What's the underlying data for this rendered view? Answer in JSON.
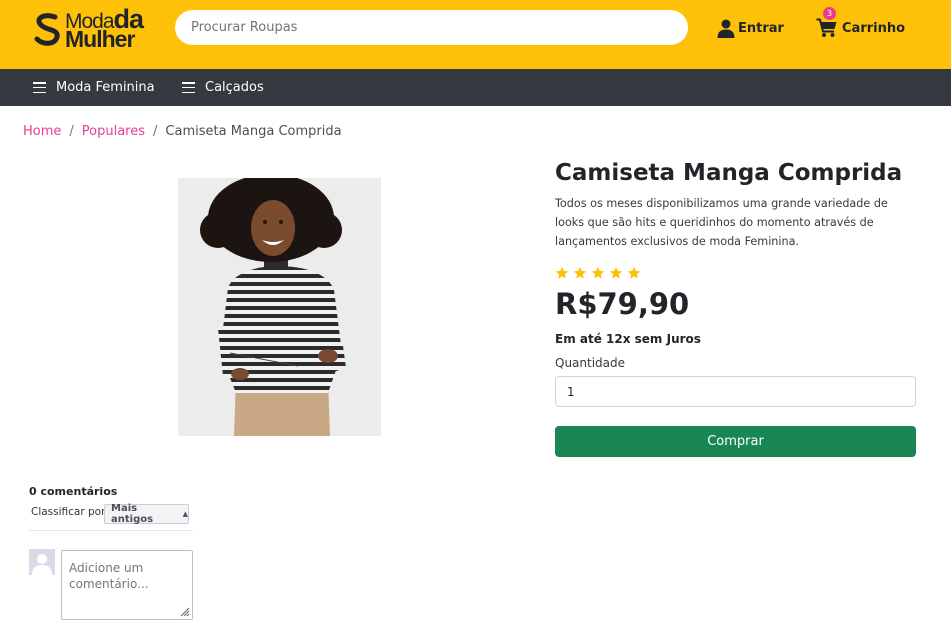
{
  "header": {
    "logo": {
      "line1_part1": "Moda",
      "line1_part2": "da",
      "line2": "Mulher"
    },
    "search": {
      "placeholder": "Procurar Roupas",
      "value": ""
    },
    "login_label": "Entrar",
    "cart_label": "Carrinho",
    "cart_count": "3",
    "icons": [
      "user-icon",
      "cart-icon"
    ],
    "brand_color": "#ffc107"
  },
  "nav": {
    "items": [
      {
        "label": "Moda Feminina",
        "icon": "menu-icon"
      },
      {
        "label": "Calçados",
        "icon": "menu-icon"
      }
    ],
    "background": "#343a40"
  },
  "breadcrumb": {
    "items": [
      {
        "label": "Home"
      },
      {
        "label": "Populares"
      }
    ],
    "separator": "/",
    "current": "Camiseta Manga Comprida"
  },
  "product": {
    "title": "Camiseta Manga Comprida",
    "description": "Todos os meses disponibilizamos uma grande variedade de looks que são hits e queridinhos do momento através de lançamentos exclusivos de moda Feminina.",
    "rating": 5,
    "rating_max": 5,
    "price": "R$79,90",
    "installments": "Em até 12x sem Juros",
    "quantity_label": "Quantidade",
    "quantity_value": "1",
    "buy_label": "Comprar",
    "buy_color": "#198754",
    "star_color": "#ffc107"
  },
  "comments": {
    "count_label": "0 comentários",
    "sort_label": "Classificar por",
    "sort_selected": "Mais antigos",
    "input_placeholder": "Adicione um comentário..."
  }
}
